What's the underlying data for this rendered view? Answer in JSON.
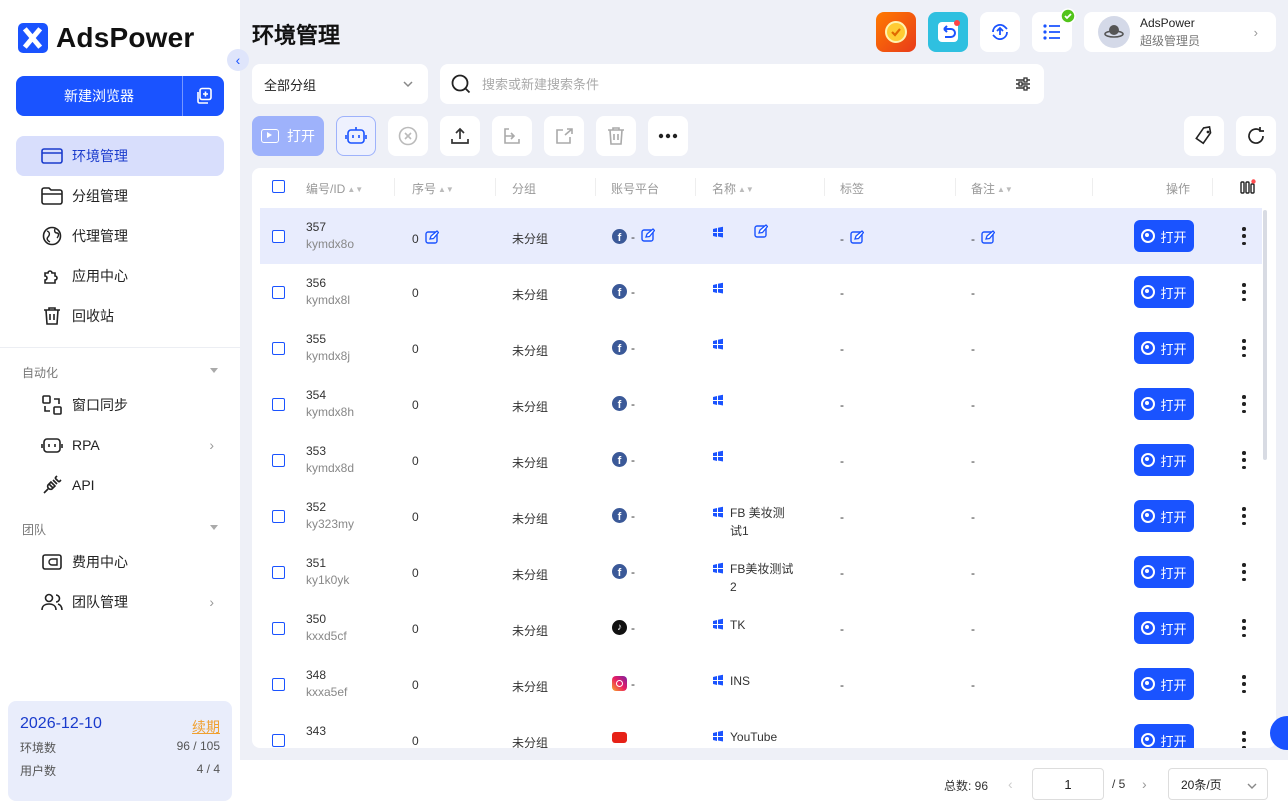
{
  "brand": {
    "name": "AdsPower"
  },
  "sidebar": {
    "new_browser_label": "新建浏览器",
    "items": [
      {
        "label": "环境管理",
        "icon": "browser-window-icon",
        "active": true
      },
      {
        "label": "分组管理",
        "icon": "folder-icon"
      },
      {
        "label": "代理管理",
        "icon": "globe-icon"
      },
      {
        "label": "应用中心",
        "icon": "puzzle-icon"
      },
      {
        "label": "回收站",
        "icon": "trash-icon"
      }
    ],
    "automation_label": "自动化",
    "automation_items": [
      {
        "label": "窗口同步",
        "icon": "sync-icon"
      },
      {
        "label": "RPA",
        "icon": "robot-icon",
        "has_submenu": true
      },
      {
        "label": "API",
        "icon": "plug-icon"
      }
    ],
    "team_label": "团队",
    "team_items": [
      {
        "label": "费用中心",
        "icon": "wallet-icon"
      },
      {
        "label": "团队管理",
        "icon": "users-icon",
        "has_submenu": true
      }
    ],
    "license": {
      "date": "2026-12-10",
      "renew_label": "续期",
      "env_label": "环境数",
      "env_value": "96 / 105",
      "user_label": "用户数",
      "user_value": "4 / 4"
    }
  },
  "header": {
    "title": "环境管理",
    "user": {
      "name": "AdsPower",
      "role": "超级管理员"
    }
  },
  "filters": {
    "group_value": "全部分组",
    "search_placeholder": "搜索或新建搜索条件"
  },
  "toolbar": {
    "open_label": "打开"
  },
  "table": {
    "headers": {
      "id": "编号/ID",
      "seq": "序号",
      "group": "分组",
      "platform": "账号平台",
      "name": "名称",
      "tag": "标签",
      "note": "备注",
      "action": "操作"
    },
    "open_label": "打开",
    "rows": [
      {
        "num": "357",
        "code": "kymdx8o",
        "seq": "0",
        "group": "未分组",
        "platform": "facebook",
        "platform_text": "-",
        "name": "",
        "tag": "-",
        "note": "-",
        "selected": true
      },
      {
        "num": "356",
        "code": "kymdx8l",
        "seq": "0",
        "group": "未分组",
        "platform": "facebook",
        "platform_text": "-",
        "name": "",
        "tag": "-",
        "note": "-"
      },
      {
        "num": "355",
        "code": "kymdx8j",
        "seq": "0",
        "group": "未分组",
        "platform": "facebook",
        "platform_text": "-",
        "name": "",
        "tag": "-",
        "note": "-"
      },
      {
        "num": "354",
        "code": "kymdx8h",
        "seq": "0",
        "group": "未分组",
        "platform": "facebook",
        "platform_text": "-",
        "name": "",
        "tag": "-",
        "note": "-"
      },
      {
        "num": "353",
        "code": "kymdx8d",
        "seq": "0",
        "group": "未分组",
        "platform": "facebook",
        "platform_text": "-",
        "name": "",
        "tag": "-",
        "note": "-"
      },
      {
        "num": "352",
        "code": "ky323my",
        "seq": "0",
        "group": "未分组",
        "platform": "facebook",
        "platform_text": "-",
        "name": "FB 美妆测试1",
        "tag": "-",
        "note": "-"
      },
      {
        "num": "351",
        "code": "ky1k0yk",
        "seq": "0",
        "group": "未分组",
        "platform": "facebook",
        "platform_text": "-",
        "name": "FB美妆测试2",
        "tag": "-",
        "note": "-"
      },
      {
        "num": "350",
        "code": "kxxd5cf",
        "seq": "0",
        "group": "未分组",
        "platform": "tiktok",
        "platform_text": "-",
        "name": "TK",
        "tag": "-",
        "note": "-"
      },
      {
        "num": "348",
        "code": "kxxa5ef",
        "seq": "0",
        "group": "未分组",
        "platform": "instagram",
        "platform_text": "-",
        "name": "INS",
        "tag": "-",
        "note": "-"
      },
      {
        "num": "343",
        "code": "",
        "seq": "0",
        "group": "未分组",
        "platform": "youtube",
        "platform_text": "",
        "name": "YouTube",
        "tag": "",
        "note": ""
      }
    ]
  },
  "pagination": {
    "total_label": "总数: 96",
    "current_page": "1",
    "total_pages_label": "/ 5",
    "page_size": "20条/页"
  },
  "colors": {
    "accent": "#1a53ff",
    "active_bg": "#d8defc",
    "renew": "#f0a030"
  }
}
